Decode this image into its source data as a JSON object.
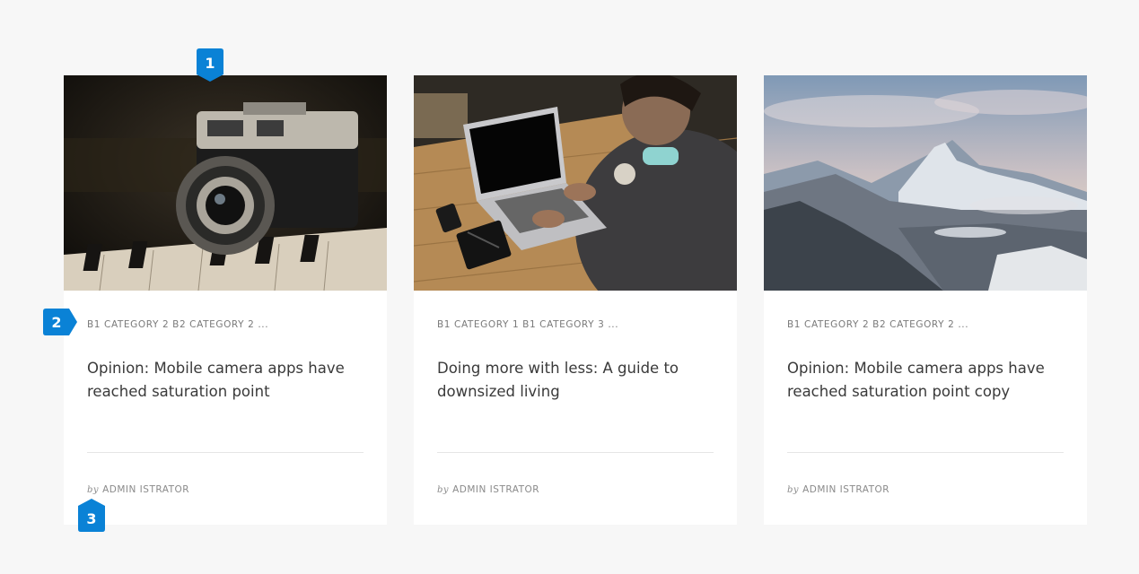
{
  "cards": [
    {
      "categories": "B1 CATEGORY 2 B2 CATEGORY 2 ...",
      "title": "Opinion: Mobile camera apps have reached saturation point",
      "by": "by",
      "author": "ADMIN ISTRATOR",
      "image": "vintage-camera-on-piano-photo"
    },
    {
      "categories": "B1 CATEGORY 1 B1 CATEGORY 3 ...",
      "title": "Doing more with less: A guide to downsized living",
      "by": "by",
      "author": "ADMIN ISTRATOR",
      "image": "person-with-laptop-on-wooden-table-photo"
    },
    {
      "categories": "B1 CATEGORY 2 B2 CATEGORY 2 ...",
      "title": "Opinion: Mobile camera apps have reached saturation point copy",
      "by": "by",
      "author": "ADMIN ISTRATOR",
      "image": "snowy-mountain-landscape-photo"
    }
  ],
  "markers": [
    "1",
    "2",
    "3"
  ],
  "colors": {
    "marker": "#0a82d6",
    "background": "#f7f7f7",
    "card": "#ffffff"
  }
}
